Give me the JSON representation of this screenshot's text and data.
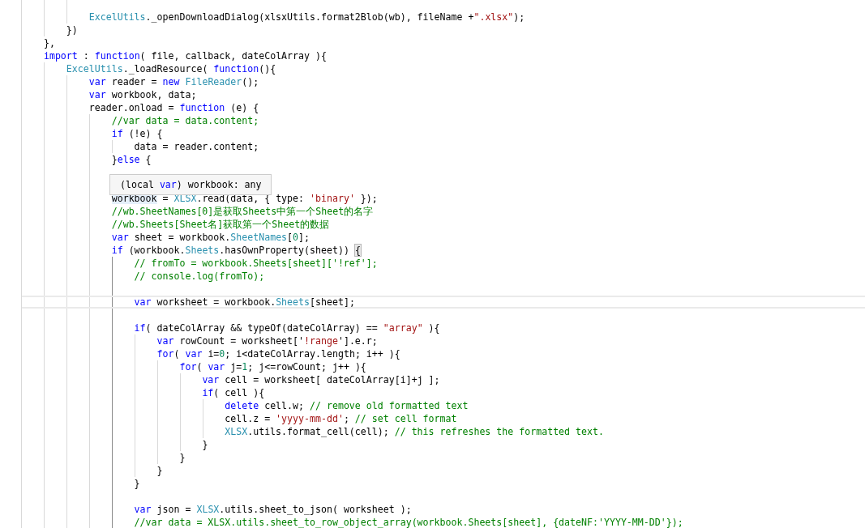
{
  "editor": {
    "lines": [
      {
        "current": false
      },
      {
        "current": false,
        "tokens": [
          {
            "kind": "type",
            "text": "            ExcelUtils"
          },
          {
            "kind": "plain",
            "text": "._openDownloadDialog(xlsxUtils.format2Blob(wb), fileName +"
          },
          {
            "kind": "string",
            "text": "\".xlsx\""
          },
          {
            "kind": "plain",
            "text": ");"
          }
        ]
      },
      {
        "current": false,
        "tokens": [
          {
            "kind": "plain",
            "text": "        })"
          }
        ]
      },
      {
        "current": false,
        "tokens": [
          {
            "kind": "plain",
            "text": "    },"
          }
        ]
      },
      {
        "current": false,
        "tokens": [
          {
            "kind": "keyword",
            "text": "    import"
          },
          {
            "kind": "plain",
            "text": " : "
          },
          {
            "kind": "keyword",
            "text": "function"
          },
          {
            "kind": "plain",
            "text": "( file, callback, dateColArray ){"
          }
        ]
      },
      {
        "current": false,
        "tokens": [
          {
            "kind": "type",
            "text": "        ExcelUtils"
          },
          {
            "kind": "plain",
            "text": "._loadResource( "
          },
          {
            "kind": "keyword",
            "text": "function"
          },
          {
            "kind": "plain",
            "text": "(){"
          }
        ]
      },
      {
        "current": false,
        "tokens": [
          {
            "kind": "keyword",
            "text": "            var"
          },
          {
            "kind": "plain",
            "text": " reader = "
          },
          {
            "kind": "keyword",
            "text": "new"
          },
          {
            "kind": "type",
            "text": " FileReader"
          },
          {
            "kind": "plain",
            "text": "();"
          }
        ]
      },
      {
        "current": false,
        "tokens": [
          {
            "kind": "keyword",
            "text": "            var"
          },
          {
            "kind": "plain",
            "text": " workbook, data;"
          }
        ]
      },
      {
        "current": false,
        "tokens": [
          {
            "kind": "plain",
            "text": "            reader.onload = "
          },
          {
            "kind": "keyword",
            "text": "function"
          },
          {
            "kind": "plain",
            "text": " (e) {"
          }
        ]
      },
      {
        "current": false,
        "tokens": [
          {
            "kind": "comment",
            "text": "                //var data = data.content;"
          }
        ]
      },
      {
        "current": false,
        "tokens": [
          {
            "kind": "keyword",
            "text": "                if"
          },
          {
            "kind": "plain",
            "text": " (!e) {"
          }
        ]
      },
      {
        "current": false,
        "tokens": [
          {
            "kind": "plain",
            "text": "                    data = reader.content;"
          }
        ]
      },
      {
        "current": false,
        "tokens": [
          {
            "kind": "plain",
            "text": "                }"
          },
          {
            "kind": "keyword",
            "text": "else"
          },
          {
            "kind": "plain",
            "text": " {"
          }
        ]
      },
      {
        "current": false
      },
      {
        "current": false
      },
      {
        "current": false,
        "tokens": [
          {
            "kind": "hover",
            "text": "                workbook"
          },
          {
            "kind": "plain",
            "text": " = "
          },
          {
            "kind": "type",
            "text": "XLSX"
          },
          {
            "kind": "plain",
            "text": ".read(data, { type: "
          },
          {
            "kind": "string",
            "text": "'binary'"
          },
          {
            "kind": "plain",
            "text": " });"
          }
        ]
      },
      {
        "current": false,
        "tokens": [
          {
            "kind": "comment",
            "text": "                //wb.SheetNames[0]是获取Sheets中第一个Sheet的名字"
          }
        ]
      },
      {
        "current": false,
        "tokens": [
          {
            "kind": "comment",
            "text": "                //wb.Sheets[Sheet名]获取第一个Sheet的数据"
          }
        ]
      },
      {
        "current": false,
        "tokens": [
          {
            "kind": "keyword",
            "text": "                var"
          },
          {
            "kind": "plain",
            "text": " sheet = workbook."
          },
          {
            "kind": "type",
            "text": "SheetNames"
          },
          {
            "kind": "plain",
            "text": "["
          },
          {
            "kind": "number",
            "text": "0"
          },
          {
            "kind": "plain",
            "text": "];"
          }
        ]
      },
      {
        "current": false,
        "tokens": [
          {
            "kind": "keyword",
            "text": "                if"
          },
          {
            "kind": "plain",
            "text": " (workbook."
          },
          {
            "kind": "type",
            "text": "Sheets"
          },
          {
            "kind": "plain",
            "text": ".hasOwnProperty(sheet)) "
          },
          {
            "kind": "match",
            "text": "{"
          }
        ]
      },
      {
        "current": false,
        "tokens": [
          {
            "kind": "comment",
            "text": "                    // fromTo = workbook.Sheets[sheet]['!ref'];"
          }
        ]
      },
      {
        "current": false,
        "tokens": [
          {
            "kind": "comment",
            "text": "                    // console.log(fromTo);"
          }
        ]
      },
      {
        "current": false
      },
      {
        "current": true,
        "tokens": [
          {
            "kind": "keyword",
            "text": "                    var"
          },
          {
            "kind": "plain",
            "text": " worksheet = workbook."
          },
          {
            "kind": "type",
            "text": "Sheets"
          },
          {
            "kind": "plain",
            "text": "[sheet];"
          }
        ]
      },
      {
        "current": false
      },
      {
        "current": false,
        "tokens": [
          {
            "kind": "keyword",
            "text": "                    if"
          },
          {
            "kind": "plain",
            "text": "( dateColArray && typeOf(dateColArray) == "
          },
          {
            "kind": "string",
            "text": "\"array\""
          },
          {
            "kind": "plain",
            "text": " ){"
          }
        ]
      },
      {
        "current": false,
        "tokens": [
          {
            "kind": "keyword",
            "text": "                        var"
          },
          {
            "kind": "plain",
            "text": " rowCount = worksheet['"
          },
          {
            "kind": "string",
            "text": "!range"
          },
          {
            "kind": "plain",
            "text": "'].e.r;"
          }
        ]
      },
      {
        "current": false,
        "tokens": [
          {
            "kind": "keyword",
            "text": "                        for"
          },
          {
            "kind": "plain",
            "text": "( "
          },
          {
            "kind": "keyword",
            "text": "var"
          },
          {
            "kind": "plain",
            "text": " i="
          },
          {
            "kind": "number",
            "text": "0"
          },
          {
            "kind": "plain",
            "text": "; i<dateColArray.length; i++ ){"
          }
        ]
      },
      {
        "current": false,
        "tokens": [
          {
            "kind": "keyword",
            "text": "                            for"
          },
          {
            "kind": "plain",
            "text": "( "
          },
          {
            "kind": "keyword",
            "text": "var"
          },
          {
            "kind": "plain",
            "text": " j="
          },
          {
            "kind": "number",
            "text": "1"
          },
          {
            "kind": "plain",
            "text": "; j<=rowCount; j++ ){"
          }
        ]
      },
      {
        "current": false,
        "tokens": [
          {
            "kind": "keyword",
            "text": "                                var"
          },
          {
            "kind": "plain",
            "text": " cell = worksheet[ dateColArray[i]+j ];"
          }
        ]
      },
      {
        "current": false,
        "tokens": [
          {
            "kind": "keyword",
            "text": "                                if"
          },
          {
            "kind": "plain",
            "text": "( cell ){"
          }
        ]
      },
      {
        "current": false,
        "tokens": [
          {
            "kind": "keyword",
            "text": "                                    delete"
          },
          {
            "kind": "plain",
            "text": " cell.w; "
          },
          {
            "kind": "comment",
            "text": "// remove old formatted text"
          }
        ]
      },
      {
        "current": false,
        "tokens": [
          {
            "kind": "plain",
            "text": "                                    cell.z = "
          },
          {
            "kind": "string",
            "text": "'yyyy-mm-dd'"
          },
          {
            "kind": "plain",
            "text": "; "
          },
          {
            "kind": "comment",
            "text": "// set cell format"
          }
        ]
      },
      {
        "current": false,
        "tokens": [
          {
            "kind": "type",
            "text": "                                    XLSX"
          },
          {
            "kind": "plain",
            "text": ".utils.format_cell(cell); "
          },
          {
            "kind": "comment",
            "text": "// this refreshes the formatted text."
          }
        ]
      },
      {
        "current": false,
        "tokens": [
          {
            "kind": "plain",
            "text": "                                }"
          }
        ]
      },
      {
        "current": false,
        "tokens": [
          {
            "kind": "plain",
            "text": "                            }"
          }
        ]
      },
      {
        "current": false,
        "tokens": [
          {
            "kind": "plain",
            "text": "                        }"
          }
        ]
      },
      {
        "current": false,
        "tokens": [
          {
            "kind": "plain",
            "text": "                    }"
          }
        ]
      },
      {
        "current": false
      },
      {
        "current": false,
        "tokens": [
          {
            "kind": "keyword",
            "text": "                    var"
          },
          {
            "kind": "plain",
            "text": " json = "
          },
          {
            "kind": "type",
            "text": "XLSX"
          },
          {
            "kind": "plain",
            "text": ".utils.sheet_to_json( worksheet );"
          }
        ]
      },
      {
        "current": false,
        "tokens": [
          {
            "kind": "comment",
            "text": "                    //var data = XLSX.utils.sheet_to_row_object_array(workbook.Sheets[sheet], {dateNF:'YYYY-MM-DD'});"
          }
        ]
      }
    ],
    "tooltip": {
      "tokens": [
        {
          "kind": "plain",
          "text": "(local "
        },
        {
          "kind": "keyword",
          "text": "var"
        },
        {
          "kind": "plain",
          "text": ") workbook: any"
        }
      ]
    }
  }
}
